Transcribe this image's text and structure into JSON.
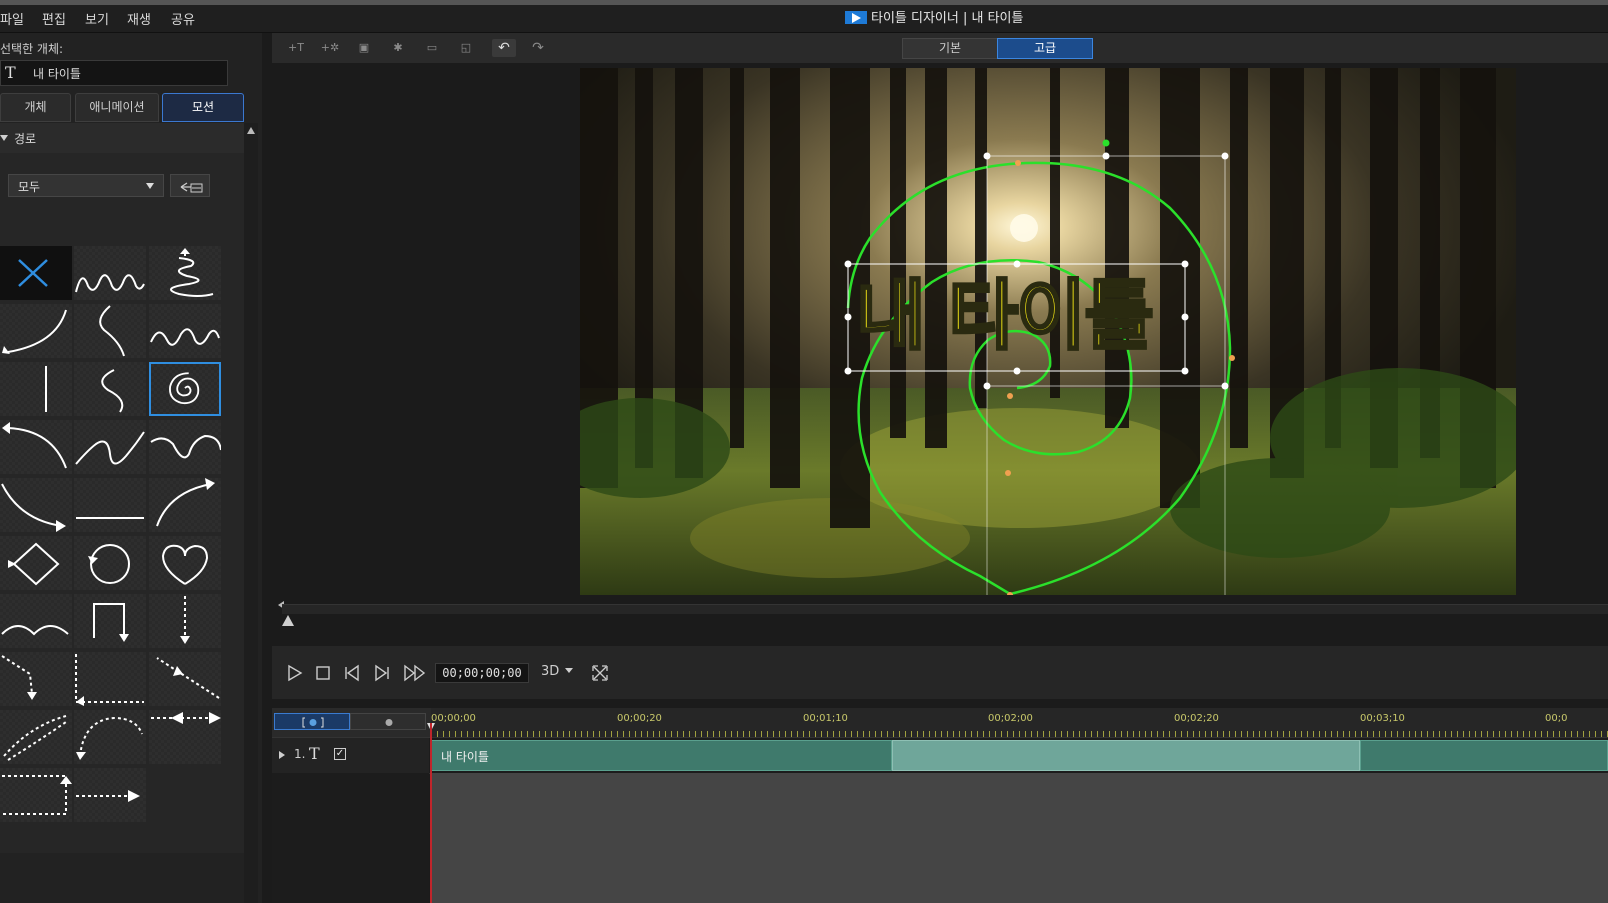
{
  "menu": [
    "파일",
    "편집",
    "보기",
    "재생",
    "공유"
  ],
  "app": {
    "title": "타이틀 디자이너 | 내 타이틀",
    "accent": "#2f8ee0"
  },
  "left_panel": {
    "selected_object_label": "선택한 개체:",
    "selected_object_icon": "text-T-icon",
    "selected_object_name": "내 타이틀",
    "tabs": [
      "개체",
      "애니메이션",
      "모션"
    ],
    "active_tab": "모션",
    "section": "경로",
    "filter": {
      "value": "모두"
    },
    "paths": [
      "none",
      "wave",
      "zigzag-up",
      "curve-down-left",
      "s-curve",
      "wave-small",
      "vertical-line",
      "s-small",
      "spiral",
      "arc-left",
      "wave-s",
      "loop-right",
      "curve-down-right",
      "horizontal-line",
      "arc-up-right",
      "diamond",
      "circle",
      "heart",
      "bumps",
      "square-u",
      "dashed-down",
      "dashed-diag-down",
      "dashed-corner",
      "dashed-diag-left",
      "dashed-loop",
      "dashed-arc",
      "dashed-double-arrow",
      "dashed-rect",
      "dashed-right-arrow"
    ],
    "selected_path": "spiral"
  },
  "toolbar": {
    "mode_basic": "기본",
    "mode_advanced": "고급",
    "active_mode": "고급"
  },
  "preview": {
    "title_text": "내 타이틀",
    "title_color": "#f3e615",
    "path_color": "#2be02b"
  },
  "transport": {
    "timecode": "00;00;00;00",
    "mode_3d": "3D"
  },
  "timeline": {
    "ticks": [
      "00;00;00",
      "00;00;20",
      "00;01;10",
      "00;02;00",
      "00;02;20",
      "00;03;10",
      "00;0"
    ],
    "track": {
      "number": "1.",
      "clip_label": "내 타이틀"
    }
  }
}
